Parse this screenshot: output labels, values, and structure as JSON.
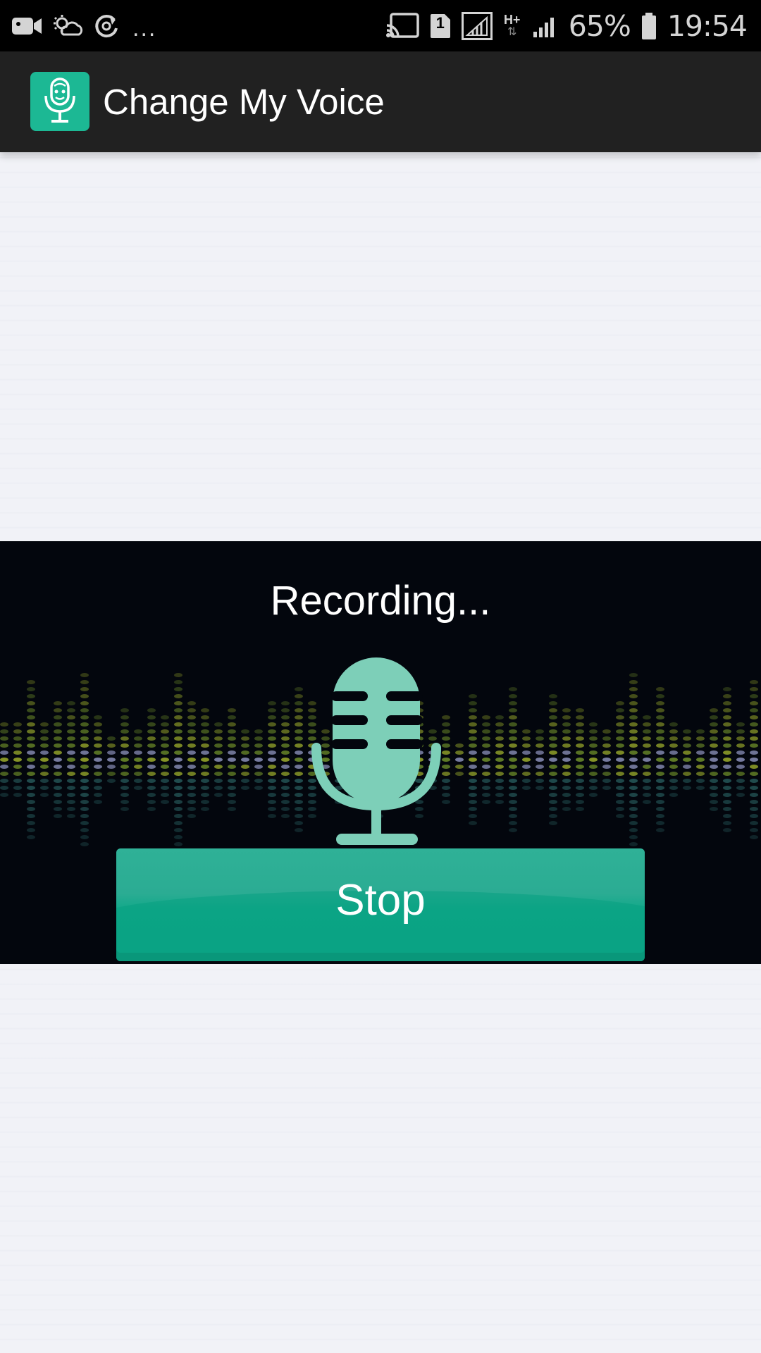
{
  "status_bar": {
    "icons": [
      "video-camera-icon",
      "weather-icon",
      "sync-icon",
      "cast-icon",
      "sim-1-icon",
      "signal-icon",
      "h-plus-data-icon",
      "signal-bars-icon",
      "battery-icon"
    ],
    "more": "...",
    "sim_label": "1",
    "network_type": "H+",
    "battery": "65%",
    "time": "19:54"
  },
  "app_bar": {
    "title": "Change My Voice",
    "icon": "microphone-app-icon",
    "icon_color": "#1cb894"
  },
  "recorder": {
    "status": "Recording...",
    "stop_label": "Stop",
    "mic_icon": "microphone-icon",
    "accent_color": "#0fa887",
    "mic_color": "#7dcfb8"
  }
}
